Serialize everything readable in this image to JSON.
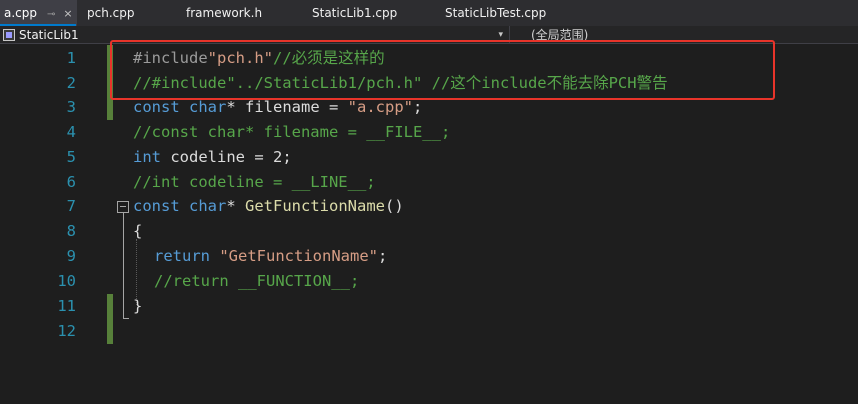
{
  "tabs": [
    {
      "label": "a.cpp",
      "active": true,
      "pin": "⊸",
      "close": "×"
    },
    {
      "label": "pch.cpp",
      "active": false
    },
    {
      "label": "framework.h",
      "active": false
    },
    {
      "label": "StaticLib1.cpp",
      "active": false
    },
    {
      "label": "StaticLibTest.cpp",
      "active": false
    }
  ],
  "nav": {
    "project": "StaticLib1",
    "project_icon": "project-icon",
    "dropdown_glyph": "▾",
    "scope": "(全局范围)"
  },
  "editor": {
    "line_numbers": [
      "1",
      "2",
      "3",
      "4",
      "5",
      "6",
      "7",
      "8",
      "9",
      "10",
      "11",
      "12"
    ],
    "lines": {
      "l1": {
        "directive": "#include",
        "path": "\"pch.h\"",
        "comment": "//必须是这样的"
      },
      "l2": {
        "comment": "//#include\"../StaticLib1/pch.h\" //这个include不能去除PCH警告"
      },
      "l3": {
        "kw1": "const",
        "kw2": "char",
        "rest": "* filename = ",
        "str": "\"a.cpp\"",
        "end": ";"
      },
      "l4": {
        "comment": "//const char* filename = __FILE__;"
      },
      "l5": {
        "kw": "int",
        "rest": " codeline = 2;"
      },
      "l6": {
        "comment": "//int codeline = __LINE__;"
      },
      "l7": {
        "kw1": "const",
        "kw2": "char",
        "rest": "* ",
        "fn": "GetFunctionName",
        "end": "()"
      },
      "l8": {
        "text": "{"
      },
      "l9": {
        "kw": "return",
        "str": "\"GetFunctionName\"",
        "end": ";"
      },
      "l10": {
        "comment": "//return __FUNCTION__;"
      },
      "l11": {
        "text": "}"
      },
      "l12": {
        "text": ""
      }
    }
  },
  "colors": {
    "highlight_box": "#e8342a",
    "change_bar": "#57803a",
    "accent": "#007acc"
  }
}
